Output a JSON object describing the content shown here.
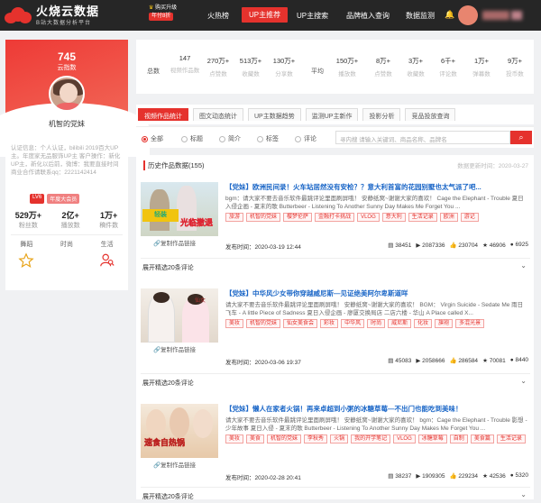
{
  "header": {
    "brand_title": "火烧云数据",
    "brand_sub": "B站大数据分析平台",
    "upgrade_label": "购买升级",
    "upgrade_badge": "年付8折",
    "nav": [
      "火热榜",
      "UP主推荐",
      "UP主搜索",
      "品牌植入查询",
      "数据监测"
    ],
    "active_nav": 1
  },
  "profile": {
    "fans_count": "745",
    "fans_label": "云指数",
    "name": "机智的党妹",
    "desc": "认证信息：个人认证，bilibili 2019百大UP主。年度家无品服饰UP主 客户操作：新化UP主，新化以后前，微博：我要直接时间 商业合作请联系qq：2221142414",
    "badge_level": "LV6",
    "badge_vip": "年度大会员",
    "stats": [
      {
        "v": "529万+",
        "k": "粉丝数"
      },
      {
        "v": "2亿+",
        "k": "播放数"
      },
      {
        "v": "1万+",
        "k": "稿件数"
      }
    ],
    "tags": [
      "舞蹈",
      "时尚",
      "生活"
    ]
  },
  "summary": {
    "total_label": "总数",
    "avg_label": "平均",
    "total": [
      {
        "v": "147",
        "k": "视频作品数"
      },
      {
        "v": "270万+",
        "k": "点赞数"
      },
      {
        "v": "513万+",
        "k": "收藏数"
      },
      {
        "v": "130万+",
        "k": "分享数"
      }
    ],
    "avg": [
      {
        "v": "150万+",
        "k": "播放数"
      },
      {
        "v": "8万+",
        "k": "点赞数"
      },
      {
        "v": "3万+",
        "k": "收藏数"
      },
      {
        "v": "6千+",
        "k": "评论数"
      },
      {
        "v": "1万+",
        "k": "弹幕数"
      },
      {
        "v": "9万+",
        "k": "投币数"
      }
    ]
  },
  "tabs": [
    "视频作品统计",
    "图文动态统计",
    "UP主数据趋势",
    "监测UP主新作",
    "投影分析",
    "竞品投放查询"
  ],
  "filters": [
    "全部",
    "标题",
    "简介",
    "标签",
    "评论"
  ],
  "search": {
    "placeholder": "寻内搜 请输入关键词、商品名称、品牌名"
  },
  "history": {
    "title": "历史作品数据(155)",
    "updated": "数据更新时间：2020-03-27"
  },
  "copy_label": "复制作品链接",
  "expand_label": "展开精选20条评论",
  "videos": [
    {
      "title": "【党妹】欧洲民间录！火车站居然没有安检？？意大利首富的花园别墅也太气派了吧...",
      "bgm": "bgm：请大家不要去音乐软件最跳评论里面刷屏哦！ 安静纸窝~谢谢大家的喜欢！ Cage the Elephant - Trouble 夏日入侵企画 - 夏末的歌 Butterbeer - Listening To Another Sunny Day Makes Me Forget You ...",
      "tags": [
        "旅游",
        "机智的党妹",
        "樱梦伦萨",
        "金融打卡挑战",
        "VLOG",
        "意大利",
        "生活记录",
        "欧洲",
        "游记"
      ],
      "date": "发布时间：2020-03-19 12:44",
      "stats": [
        "38451",
        "2087336",
        "230704",
        "46906",
        "6925"
      ],
      "thumb_text": "光临撤退"
    },
    {
      "title": "【党妹】中华风少女带你穿越威尼斯—见证绝美阿尔卑斯道咩",
      "bgm": "请大家不要去音乐软件最跳评论里面刷屏哦！ 安静纸窝~谢谢大家的喜欢！ BGM： Virgin Suicide - Sedate Me 雨日飞车 - A little Piece of Sadness 夏日入侵企画 - 廖厦交换局店 二店六楼 - 华山 A Place called X...",
      "tags": [
        "美妆",
        "机智的党妹",
        "仙女美食会",
        "彩妆",
        "中华风",
        "时尚",
        "威尼斯",
        "化妆",
        "旗袍",
        "多混光景"
      ],
      "date": "发布时间：2020-03-06 19:37",
      "stats": [
        "45083",
        "2058666",
        "286584",
        "70081",
        "8440"
      ],
      "thumb_text": ""
    },
    {
      "title": "【党妹】懒人在家者火锅！再来卓超到小粥的冰糖草莓—不出门也能吃到美味！",
      "bgm": "请大家不要去音乐软件最跳评论里面刷屏哦！ 安静纸窝~谢谢大家的喜欢！ bgm：Cage the Elephant - Trouble 影想 - 少年故事 夏日入侵 - 夏末的歌 Butterbeer - Listening To Another Sunny Day Makes Me Forget You ...",
      "tags": [
        "美妆",
        "美食",
        "机智的党妹",
        "李秋秀",
        "火锅",
        "我的开学笔记",
        "VLOG",
        "冰糖草莓",
        "自制",
        "美食篇",
        "生活记录"
      ],
      "date": "发布时间：2020-02-28 20:41",
      "stats": [
        "38237",
        "1909305",
        "229234",
        "42536",
        "5320"
      ],
      "thumb_text": "速食自热锅"
    }
  ]
}
